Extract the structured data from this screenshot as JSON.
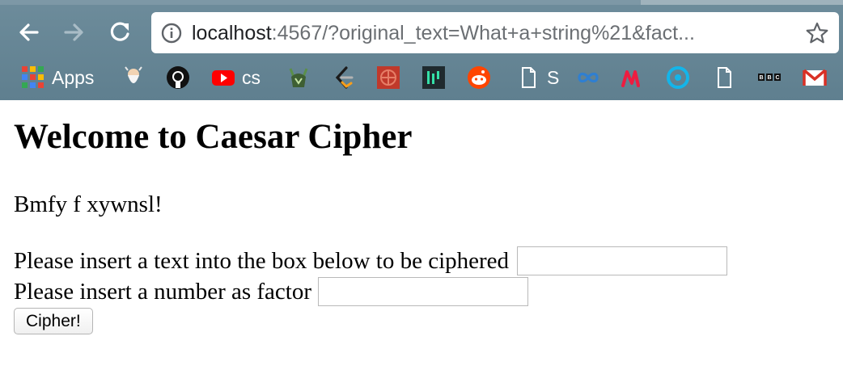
{
  "browser": {
    "url_host": "localhost",
    "url_rest": ":4567/?original_text=What+a+string%21&fact..."
  },
  "bookmarks": [
    {
      "label": "Apps",
      "icon": "apps-grid-icon"
    },
    {
      "label": "",
      "icon": "bearded-man-icon"
    },
    {
      "label": "",
      "icon": "github-icon"
    },
    {
      "label": "cs",
      "icon": "youtube-icon"
    },
    {
      "label": "",
      "icon": "viking-helmet-icon"
    },
    {
      "label": "",
      "icon": "leetcode-icon"
    },
    {
      "label": "",
      "icon": "red-pattern-icon"
    },
    {
      "label": "",
      "icon": "green-bars-icon"
    },
    {
      "label": "",
      "icon": "reddit-icon"
    },
    {
      "label": "S",
      "icon": "document-icon"
    },
    {
      "label": "",
      "icon": "infinity-icon"
    },
    {
      "label": "",
      "icon": "meetup-icon"
    },
    {
      "label": "",
      "icon": "target-ring-icon"
    },
    {
      "label": "",
      "icon": "document-icon"
    },
    {
      "label": "BBC",
      "icon": "bbc-icon"
    },
    {
      "label": "",
      "icon": "gmail-icon"
    }
  ],
  "page": {
    "title": "Welcome to Caesar Cipher",
    "result_text": "Bmfy f xywnsl!",
    "text_prompt": "Please insert a text into the box below to be ciphered",
    "text_value": "",
    "factor_prompt": "Please insert a number as factor",
    "factor_value": "",
    "submit_label": "Cipher!"
  }
}
